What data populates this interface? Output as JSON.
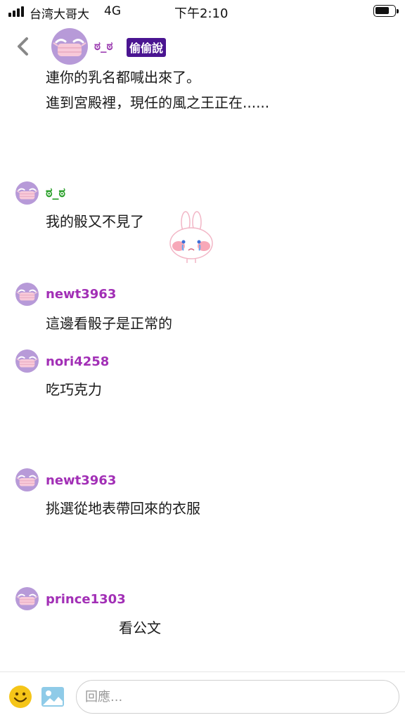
{
  "status_bar": {
    "carrier": "台湾大哥大",
    "network": "4G",
    "time": "下午2:10",
    "battery_fill": 0.75
  },
  "header": {
    "back_icon": "chevron-left-icon",
    "name": "ಠ_ಠ",
    "whisper_label": "偷偷說",
    "message_line1": "連你的乳名都喊出來了。",
    "message_line2": "進到宮殿裡，現任的風之王正在......"
  },
  "messages": [
    {
      "username": "ಠ_ಠ",
      "text": "我的骰又不見了",
      "sticker": "crying-bunny-sticker"
    },
    {
      "username": "newt3963",
      "text": "這邊看骰子是正常的"
    },
    {
      "username": "nori4258",
      "text": "吃巧克力"
    },
    {
      "username": "newt3963",
      "text": "挑選從地表帶回來的衣服"
    },
    {
      "username": "prince1303",
      "text": "看公文"
    }
  ],
  "input_bar": {
    "placeholder": "回應...",
    "emoji_icon": "smiley-icon",
    "image_icon": "image-icon"
  },
  "colors": {
    "username": "#a22fb6",
    "username_green": "#2aa02a",
    "badge_bg": "#4a1591",
    "avatar": "#b79ad8"
  }
}
